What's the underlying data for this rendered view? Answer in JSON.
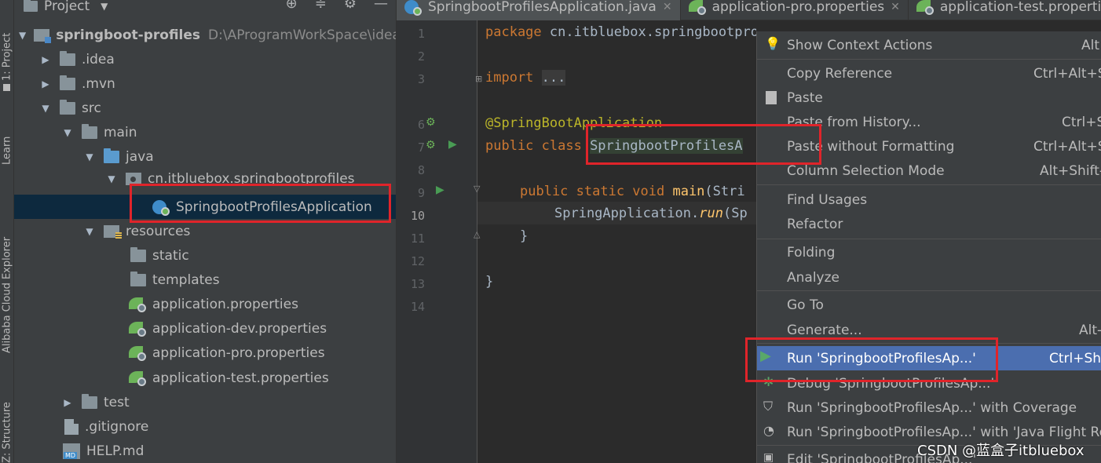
{
  "sidebar_tabs": [
    "1: Project",
    "Learn",
    "Alibaba Cloud Explorer",
    "Z: Structure"
  ],
  "project_panel": {
    "title": "Project",
    "tree": [
      {
        "label": "springboot-profiles",
        "path": "D:\\AProgramWorkSpace\\idea\\s",
        "type": "module",
        "expanded": true
      },
      {
        "label": ".idea",
        "type": "folder",
        "expanded": false
      },
      {
        "label": ".mvn",
        "type": "folder",
        "expanded": false
      },
      {
        "label": "src",
        "type": "folder",
        "expanded": true
      },
      {
        "label": "main",
        "type": "folder",
        "expanded": true
      },
      {
        "label": "java",
        "type": "folder-source",
        "expanded": true
      },
      {
        "label": "cn.itbluebox.springbootprofiles",
        "type": "package",
        "expanded": true
      },
      {
        "label": "SpringbootProfilesApplication",
        "type": "spring-class",
        "selected": true
      },
      {
        "label": "resources",
        "type": "folder-resources",
        "expanded": true
      },
      {
        "label": "static",
        "type": "folder"
      },
      {
        "label": "templates",
        "type": "folder"
      },
      {
        "label": "application.properties",
        "type": "spring-properties"
      },
      {
        "label": "application-dev.properties",
        "type": "spring-properties"
      },
      {
        "label": "application-pro.properties",
        "type": "spring-properties"
      },
      {
        "label": "application-test.properties",
        "type": "spring-properties"
      },
      {
        "label": "test",
        "type": "folder",
        "expanded": false
      },
      {
        "label": ".gitignore",
        "type": "file"
      },
      {
        "label": "HELP.md",
        "type": "markdown"
      }
    ]
  },
  "editor_tabs": [
    {
      "label": "SpringbootProfilesApplication.java",
      "active": true
    },
    {
      "label": "application-pro.properties",
      "active": false
    },
    {
      "label": "application-test.properties",
      "active": false
    }
  ],
  "editor": {
    "line_numbers": [
      "1",
      "2",
      "3",
      "6",
      "7",
      "8",
      "9",
      "10",
      "11",
      "12",
      "13",
      "14"
    ],
    "current_line": "10",
    "code": {
      "line1_kw": "package",
      "line1_rest": " cn.itbluebox.springbootprofiles;",
      "line3_kw": "import",
      "line3_fold": "...",
      "line6": "@SpringBootApplication",
      "line7_kw": "public class ",
      "line7_cls": "SpringbootProfilesA",
      "line9_kw": "public static void ",
      "line9_id": "main",
      "line9_rest": "(Stri",
      "line10_cls": "SpringApplication",
      "line10_dot": ".",
      "line10_m": "run",
      "line10_rest": "(Sp",
      "line11": "}",
      "line13": "}"
    }
  },
  "context_menu": {
    "items": [
      {
        "label": "Show Context Actions",
        "shortcut": "Alt",
        "icon": "lightbulb-icon"
      },
      {
        "label": "Copy Reference",
        "shortcut": "Ctrl+Alt+S"
      },
      {
        "label": "Paste",
        "shortcut": "",
        "icon": "clipboard-icon"
      },
      {
        "label": "Paste from History...",
        "shortcut": "Ctrl+S"
      },
      {
        "label": "Paste without Formatting",
        "shortcut": "Ctrl+Alt+S"
      },
      {
        "label": "Column Selection Mode",
        "shortcut": "Alt+Shift-"
      },
      {
        "label": "Find Usages",
        "shortcut": ""
      },
      {
        "label": "Refactor",
        "shortcut": ""
      },
      {
        "label": "Folding",
        "shortcut": ""
      },
      {
        "label": "Analyze",
        "shortcut": ""
      },
      {
        "label": "Go To",
        "shortcut": ""
      },
      {
        "label": "Generate...",
        "shortcut": "Alt-"
      },
      {
        "label": "Run 'SpringbootProfilesAp...'",
        "shortcut": "Ctrl+Shi",
        "icon": "run-icon",
        "active": true
      },
      {
        "label": "Debug 'SpringbootProfilesAp...'",
        "shortcut": "",
        "icon": "debug-icon"
      },
      {
        "label": "Run 'SpringbootProfilesAp...' with Coverage",
        "shortcut": "",
        "icon": "coverage-icon"
      },
      {
        "label": "Run 'SpringbootProfilesAp...' with 'Java Flight Rec",
        "shortcut": "",
        "icon": "profiler-icon"
      },
      {
        "label": "Edit 'SpringbootProfilesAp...'",
        "shortcut": "",
        "icon": "edit-config-icon"
      }
    ]
  },
  "watermark": "CSDN @蓝盒子itbluebox",
  "colors": {
    "highlight_box": "#e0242a",
    "menu_active": "#4b6eaf",
    "selection": "#0d293e"
  }
}
